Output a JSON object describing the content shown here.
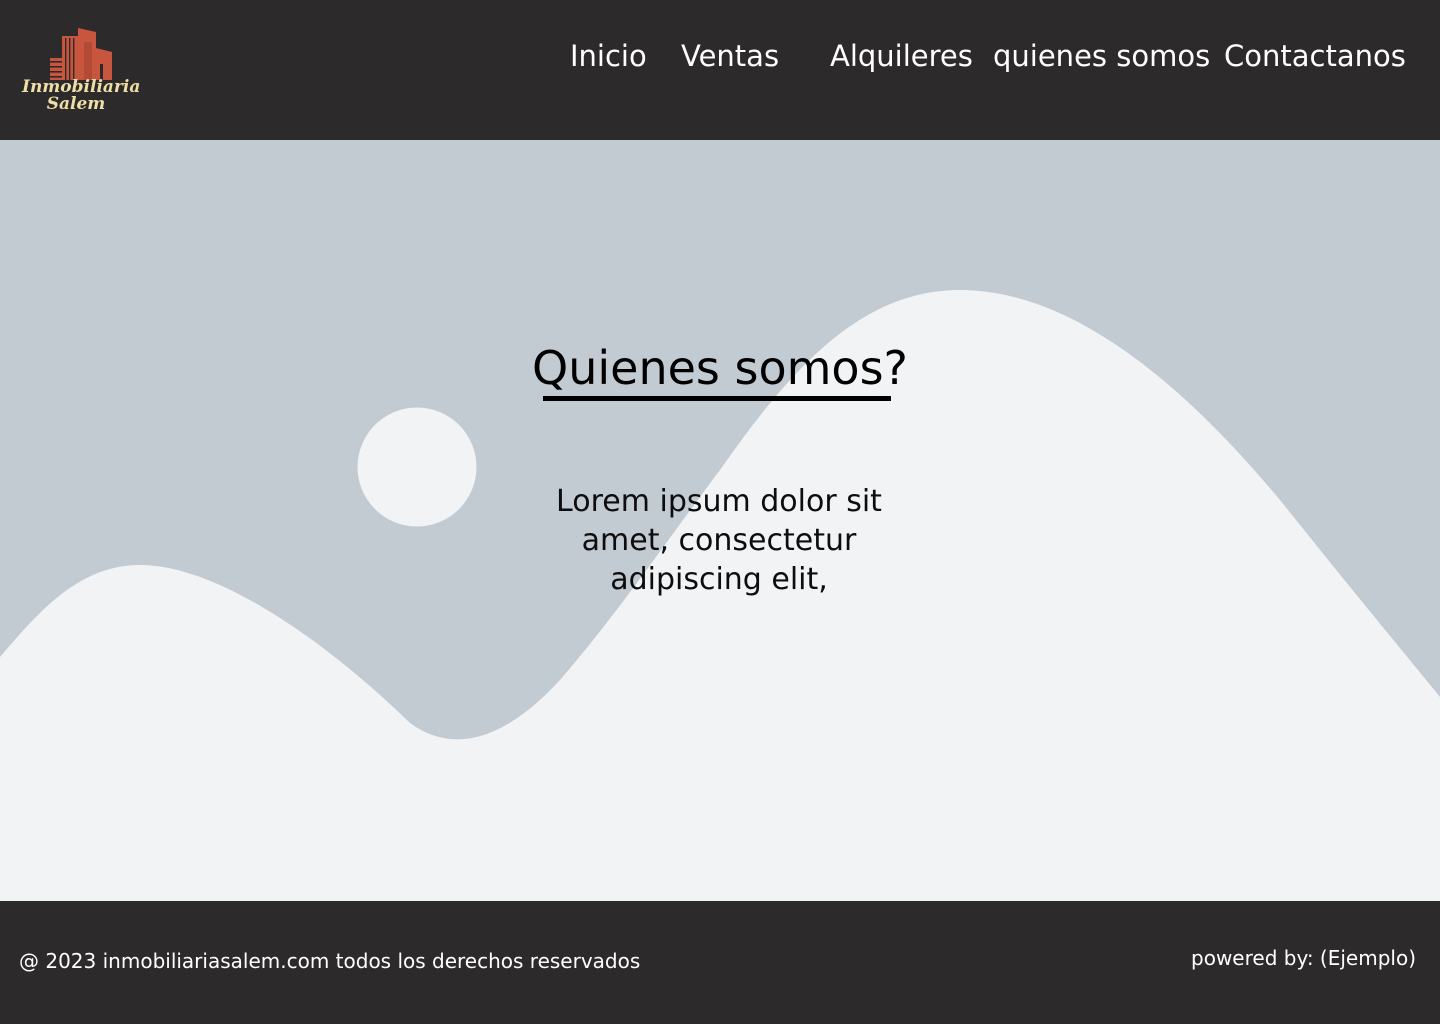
{
  "brand": {
    "line1": "Inmobiliaria",
    "line2": "Salem",
    "logo_icon": "building-logo-icon",
    "logo_color": "#c8553d",
    "text_color": "#eedfa6"
  },
  "nav": {
    "items": [
      {
        "label": "Inicio"
      },
      {
        "label": "Ventas"
      },
      {
        "label": "Alquileres"
      },
      {
        "label": "quienes somos"
      },
      {
        "label": "Contactanos"
      }
    ]
  },
  "main": {
    "title": "Quienes somos?",
    "body": "Lorem ipsum dolor sit amet, consectetur adipiscing elit,"
  },
  "footer": {
    "copyright": "@ 2023 inmobiliariasalem.com todos los derechos reservados",
    "powered_by": "powered by: (Ejemplo)"
  },
  "colors": {
    "header_bg": "#2d2a2b",
    "main_bg": "#c2cad2",
    "hills": "#f1f3f5",
    "text_dark": "#000000",
    "text_light": "#ffffff"
  }
}
